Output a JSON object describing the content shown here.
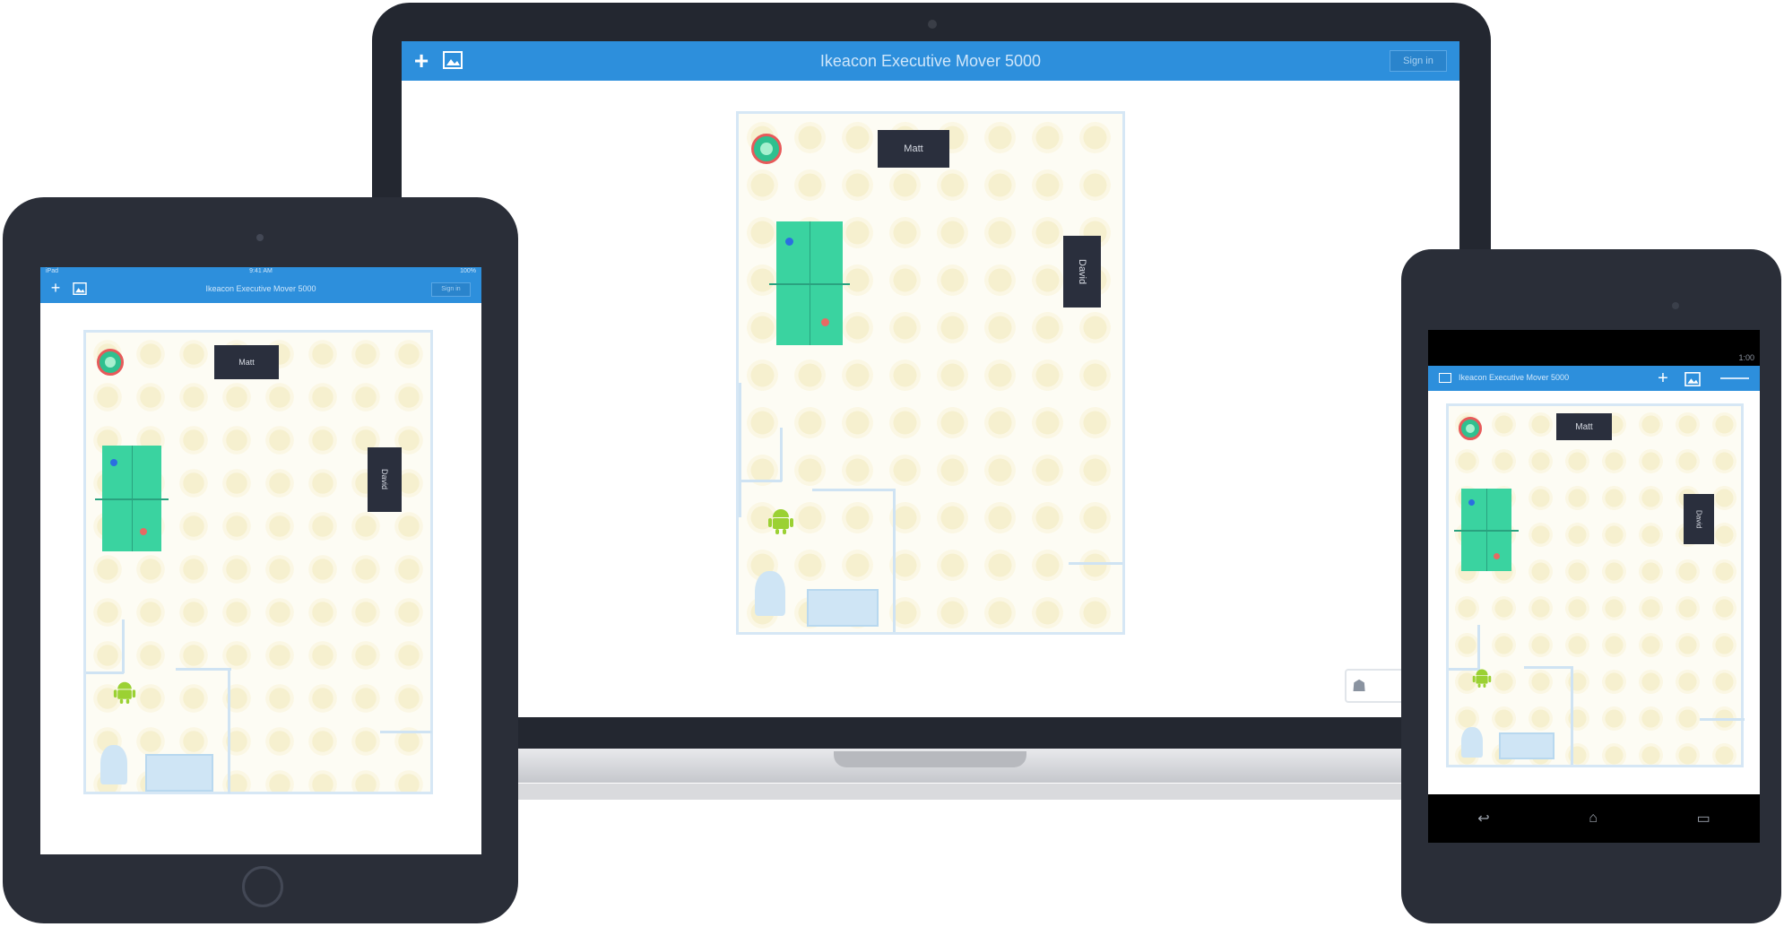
{
  "app": {
    "title": "Ikeacon Executive Mover 5000",
    "right_button": "Sign in"
  },
  "icons": {
    "add": "plus-icon",
    "image": "image-icon",
    "robot": "robot-icon",
    "sensor": "sensor-icon"
  },
  "map": {
    "door_top_label": "Matt",
    "door_right_label": "David"
  },
  "tablet": {
    "status_left": "iPad",
    "status_center": "9:41 AM",
    "status_right": "100%"
  },
  "phone": {
    "status_right": "1:00",
    "nav_back": "back-icon",
    "nav_home": "home-icon",
    "nav_recent": "recent-apps-icon"
  },
  "colors": {
    "accent": "#2d8fdc",
    "bezel": "#232730",
    "table": "#3ad3a0",
    "robot": "#9bd133",
    "door": "#2a2f3d"
  }
}
